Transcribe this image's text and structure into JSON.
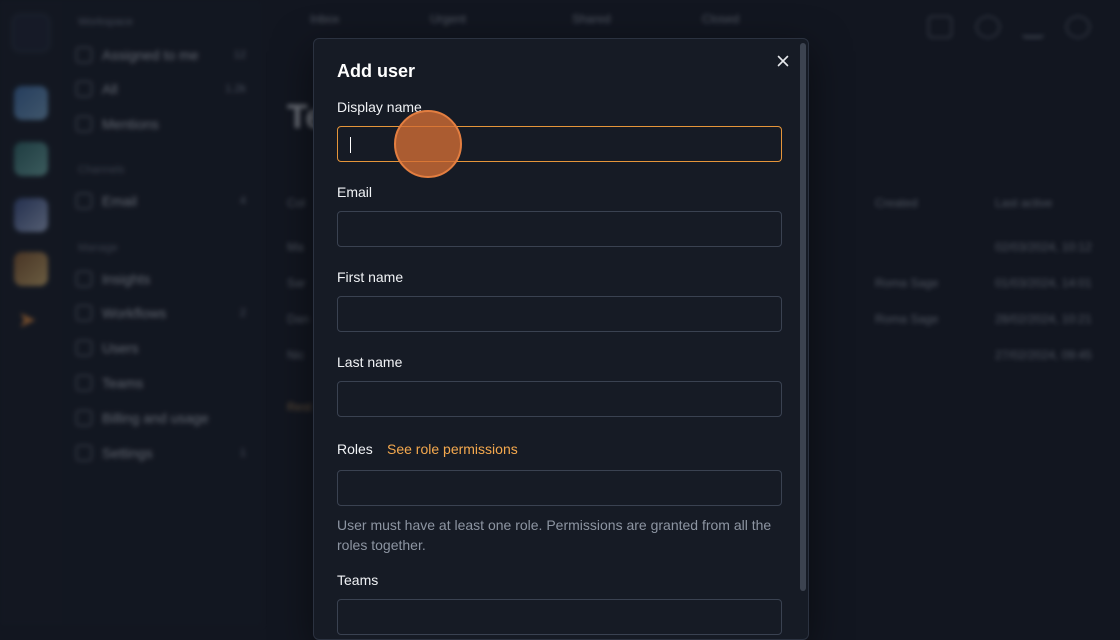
{
  "background": {
    "sidebar": {
      "title": "Workspace",
      "items": [
        {
          "label": "Assigned to me",
          "count": "12"
        },
        {
          "label": "All",
          "count": "1.2k"
        },
        {
          "label": "Mentions",
          "count": ""
        }
      ],
      "section_channels": "Channels",
      "channel_items": [
        {
          "label": "Email",
          "count": "4"
        }
      ],
      "section_manage": "Manage",
      "manage_items": [
        {
          "label": "Insights",
          "count": ""
        },
        {
          "label": "Workflows",
          "count": "2"
        },
        {
          "label": "Users",
          "count": ""
        },
        {
          "label": "Teams",
          "count": ""
        },
        {
          "label": "Billing and usage",
          "count": ""
        },
        {
          "label": "Settings",
          "count": "1"
        }
      ]
    },
    "tabs": [
      "Inbox",
      "Urgent",
      "Shared",
      "Closed"
    ],
    "page_title": "Te",
    "table_rows": [
      {
        "c1": "Col",
        "c2": "Created",
        "c3": "Last active"
      },
      {
        "c1": "Ma",
        "c2": "",
        "c3": "02/03/2024, 10:12"
      },
      {
        "c1": "Sar",
        "c2": "Roma Sage",
        "c3": "01/03/2024, 14:01"
      },
      {
        "c1": "Dan",
        "c2": "Roma Sage",
        "c3": "28/02/2024, 10:21"
      },
      {
        "c1": "Nic",
        "c2": "",
        "c3": "27/02/2024, 09:45"
      }
    ],
    "footer_link": "Rest"
  },
  "modal": {
    "title": "Add user",
    "fields": {
      "display_name": {
        "label": "Display name",
        "value": ""
      },
      "email": {
        "label": "Email",
        "value": ""
      },
      "first_name": {
        "label": "First name",
        "value": ""
      },
      "last_name": {
        "label": "Last name",
        "value": ""
      },
      "roles": {
        "label": "Roles",
        "value": ""
      },
      "teams": {
        "label": "Teams",
        "value": ""
      }
    },
    "roles_link": "See role permissions",
    "roles_help": "User must have at least one role. Permissions are granted from all the roles together."
  },
  "colors": {
    "accent": "#e5953a",
    "link": "#f5a94e",
    "modal_bg": "#161b25",
    "page_bg": "#121620",
    "click_indicator": "#d66e34"
  },
  "icons": {
    "close": "close-icon"
  }
}
